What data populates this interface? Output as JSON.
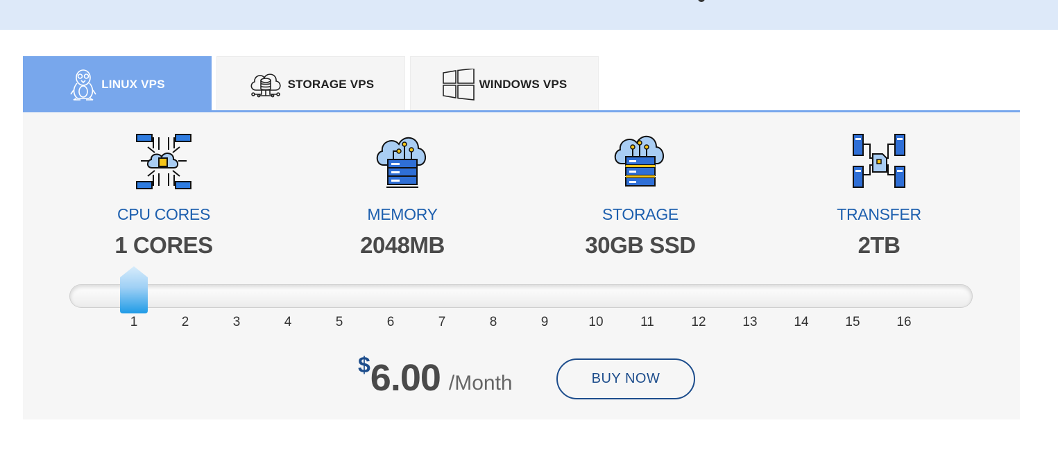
{
  "tabs": [
    {
      "label": "LINUX VPS",
      "icon": "penguin-icon",
      "active": true
    },
    {
      "label": "STORAGE VPS",
      "icon": "cloud-database-icon",
      "active": false
    },
    {
      "label": "WINDOWS VPS",
      "icon": "windows-icon",
      "active": false
    }
  ],
  "specs": [
    {
      "title": "CPU CORES",
      "value": "1 CORES",
      "icon": "cloud-cpu-icon"
    },
    {
      "title": "MEMORY",
      "value": "2048MB",
      "icon": "cloud-server-icon"
    },
    {
      "title": "STORAGE",
      "value": "30GB SSD",
      "icon": "cloud-storage-icon"
    },
    {
      "title": "TRANSFER",
      "value": "2TB",
      "icon": "network-transfer-icon"
    }
  ],
  "slider": {
    "ticks": [
      "1",
      "2",
      "3",
      "4",
      "5",
      "6",
      "7",
      "8",
      "9",
      "10",
      "11",
      "12",
      "13",
      "14",
      "15",
      "16"
    ],
    "selected": 1
  },
  "price": {
    "currency": "$",
    "amount": "6.00",
    "period": "/Month"
  },
  "buy_label": "BUY NOW",
  "colors": {
    "accent_tab": "#78a7ec",
    "brand_blue": "#1d5fae",
    "price_currency": "#1d4d8c",
    "band": "#dde9f9",
    "handle": "#2ea6ea"
  }
}
